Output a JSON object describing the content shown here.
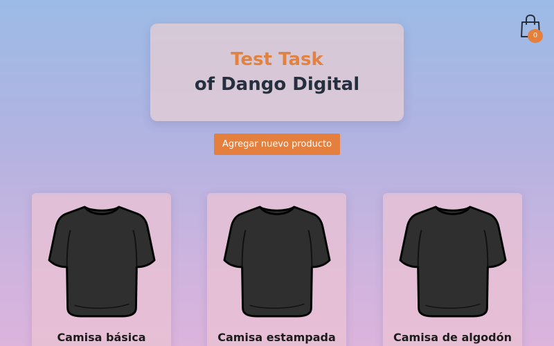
{
  "cart": {
    "icon": "shopping-bag-icon",
    "count": "0",
    "badge_color": "#e57f3e"
  },
  "hero": {
    "line1": "Test Task",
    "line2": "of Dango Digital",
    "accent_color": "#e3823f",
    "text_color": "#262f3d"
  },
  "actions": {
    "add_product_label": "Agregar nuevo producto",
    "button_color": "#e57f3e"
  },
  "products": [
    {
      "name": "Camisa básica",
      "image_icon": "t-shirt-icon"
    },
    {
      "name": "Camisa estampada",
      "image_icon": "t-shirt-icon"
    },
    {
      "name": "Camisa de algodón",
      "image_icon": "t-shirt-icon"
    }
  ]
}
